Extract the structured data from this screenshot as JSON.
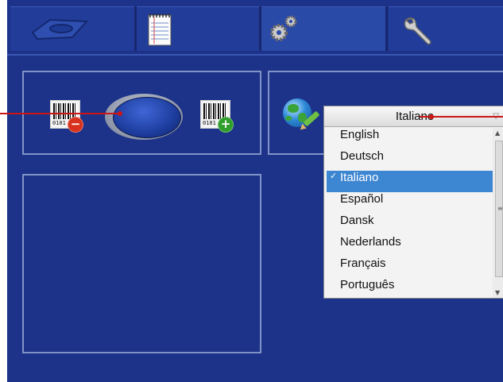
{
  "tabs": [
    {
      "name": "tab-device",
      "icon": "device-tray-icon"
    },
    {
      "name": "tab-notes",
      "icon": "notepad-icon"
    },
    {
      "name": "tab-settings",
      "icon": "gears-icon",
      "active": true
    },
    {
      "name": "tab-tools",
      "icon": "wrench-icon"
    }
  ],
  "barcode": {
    "left_digits": "0101",
    "right_digits": "0101",
    "minus_symbol": "−",
    "plus_symbol": "+"
  },
  "toggle": {
    "icon": "toggle-switch"
  },
  "language": {
    "icon": "globe-pencil-icon",
    "selected": "Italiano",
    "check_mark": "✓",
    "arrow_symbol": "▽",
    "options": [
      "English",
      "Deutsch",
      "Italiano",
      "Español",
      "Dansk",
      "Nederlands",
      "Français",
      "Português"
    ]
  },
  "scrollbar": {
    "up": "▲",
    "down": "▼",
    "grip": "≡"
  },
  "colors": {
    "background": "#1c3389",
    "panel_border": "#8193c6",
    "callout": "#cc1515",
    "highlight": "#3d86d1"
  }
}
